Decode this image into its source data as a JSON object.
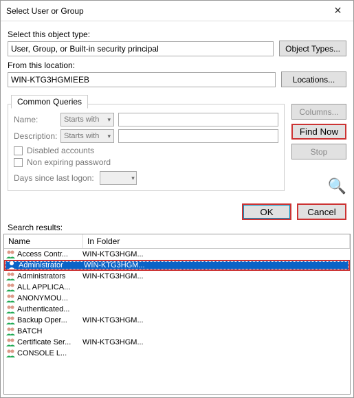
{
  "window": {
    "title": "Select User or Group"
  },
  "labels": {
    "object_type": "Select this object type:",
    "from_location": "From this location:",
    "tab": "Common Queries",
    "name": "Name:",
    "description": "Description:",
    "starts_with": "Starts with",
    "disabled": "Disabled accounts",
    "nonexp": "Non expiring password",
    "days": "Days since last logon:",
    "results": "Search results:",
    "col_name": "Name",
    "col_folder": "In Folder"
  },
  "fields": {
    "object_type": "User, Group, or Built-in security principal",
    "location": "WIN-KTG3HGMIEEB"
  },
  "buttons": {
    "object_types": "Object Types...",
    "locations": "Locations...",
    "columns": "Columns...",
    "findnow": "Find Now",
    "stop": "Stop",
    "ok": "OK",
    "cancel": "Cancel"
  },
  "results": [
    {
      "icon": "group",
      "name": "Access Contr...",
      "folder": "WIN-KTG3HGM...",
      "selected": false
    },
    {
      "icon": "user",
      "name": "Administrator",
      "folder": "WIN-KTG3HGM...",
      "selected": true
    },
    {
      "icon": "group",
      "name": "Administrators",
      "folder": "WIN-KTG3HGM...",
      "selected": false
    },
    {
      "icon": "group",
      "name": "ALL APPLICA...",
      "folder": "",
      "selected": false
    },
    {
      "icon": "group",
      "name": "ANONYMOU...",
      "folder": "",
      "selected": false
    },
    {
      "icon": "group",
      "name": "Authenticated...",
      "folder": "",
      "selected": false
    },
    {
      "icon": "group",
      "name": "Backup Oper...",
      "folder": "WIN-KTG3HGM...",
      "selected": false
    },
    {
      "icon": "group",
      "name": "BATCH",
      "folder": "",
      "selected": false
    },
    {
      "icon": "group",
      "name": "Certificate Ser...",
      "folder": "WIN-KTG3HGM...",
      "selected": false
    },
    {
      "icon": "group",
      "name": "CONSOLE L...",
      "folder": "",
      "selected": false
    }
  ]
}
